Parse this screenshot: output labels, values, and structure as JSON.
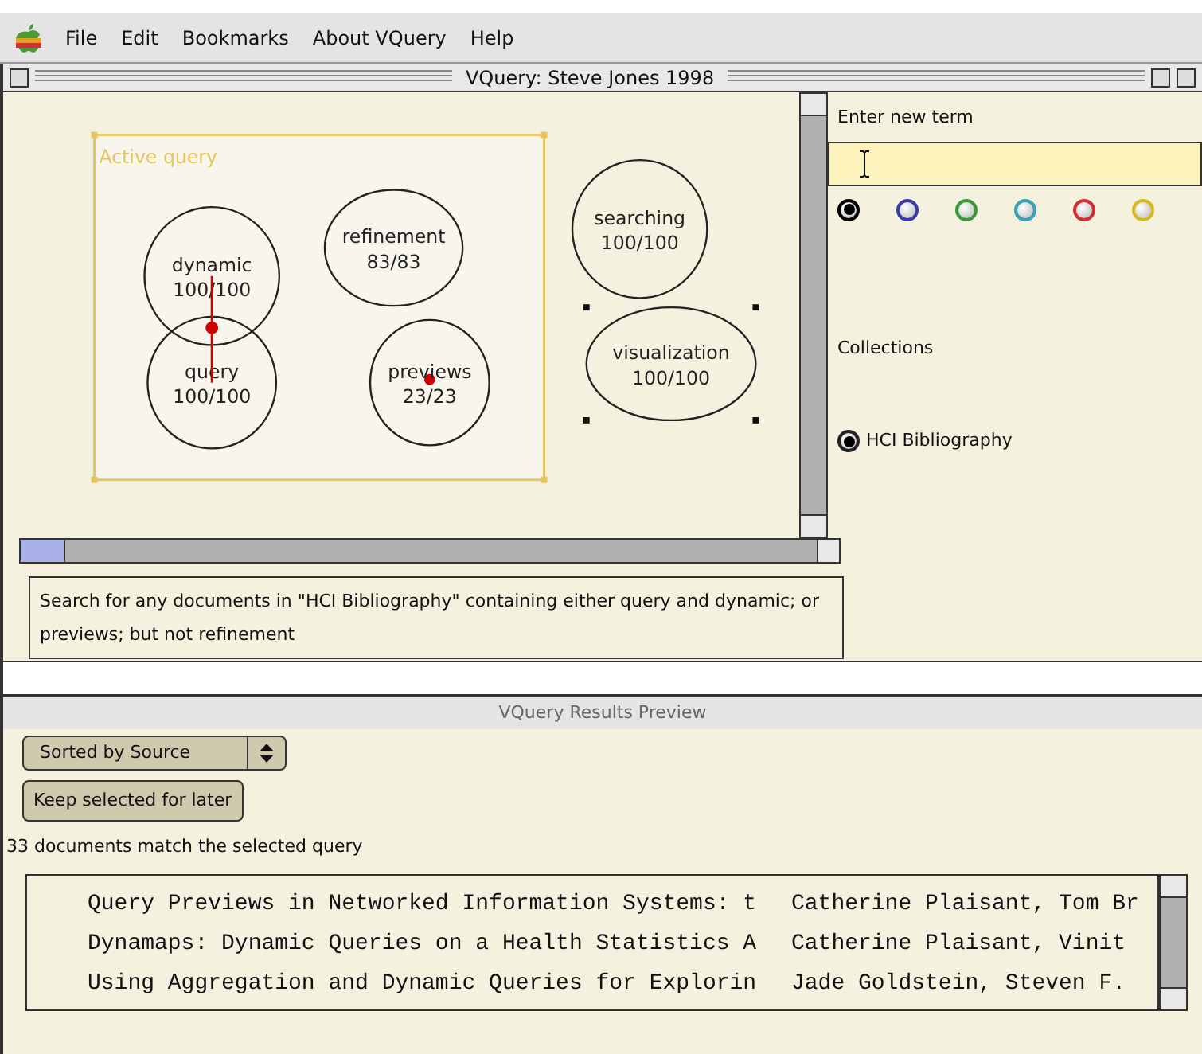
{
  "menu_bar": {
    "items": [
      "File",
      "Edit",
      "Bookmarks",
      "About VQuery",
      "Help"
    ]
  },
  "window": {
    "title": "VQuery: Steve Jones 1998"
  },
  "canvas": {
    "active_query_label": "Active query",
    "nodes": [
      {
        "label": "dynamic",
        "count": "100/100",
        "selected": false,
        "marked": false,
        "linked_to_next": true
      },
      {
        "label": "query",
        "count": "100/100",
        "selected": false,
        "marked": false
      },
      {
        "label": "refinement",
        "count": "83/83",
        "selected": false,
        "marked": false
      },
      {
        "label": "previews",
        "count": "23/23",
        "selected": false,
        "marked": true
      },
      {
        "label": "searching",
        "count": "100/100",
        "selected": false,
        "marked": false
      },
      {
        "label": "visualization",
        "count": "100/100",
        "selected": true,
        "marked": false
      }
    ]
  },
  "query_description": "Search for any documents in \"HCI Bibliography\" containing either query and dynamic; or previews; but not refinement",
  "term_panel": {
    "label": "Enter new term",
    "colors": [
      {
        "color": "#000000",
        "selected": true
      },
      {
        "color": "#3b3ba8",
        "selected": false
      },
      {
        "color": "#3a9a3a",
        "selected": false
      },
      {
        "color": "#3aa0b8",
        "selected": false
      },
      {
        "color": "#d03030",
        "selected": false
      },
      {
        "color": "#d8b820",
        "selected": false
      }
    ],
    "collections_label": "Collections",
    "collections": [
      {
        "label": "HCI Bibliography",
        "selected": true
      }
    ]
  },
  "results": {
    "title": "VQuery Results Preview",
    "sort": "Sorted by Source",
    "keep_button": "Keep selected for later",
    "count_text": "33 documents match the selected query",
    "rows": [
      {
        "title": "Query Previews in Networked Information Systems: t",
        "authors": "Catherine Plaisant, Tom Br"
      },
      {
        "title": "Dynamaps: Dynamic Queries on a Health Statistics A",
        "authors": "Catherine Plaisant, Vinit"
      },
      {
        "title": "Using Aggregation and Dynamic Queries for Explorin",
        "authors": "Jade Goldstein, Steven F."
      }
    ]
  }
}
